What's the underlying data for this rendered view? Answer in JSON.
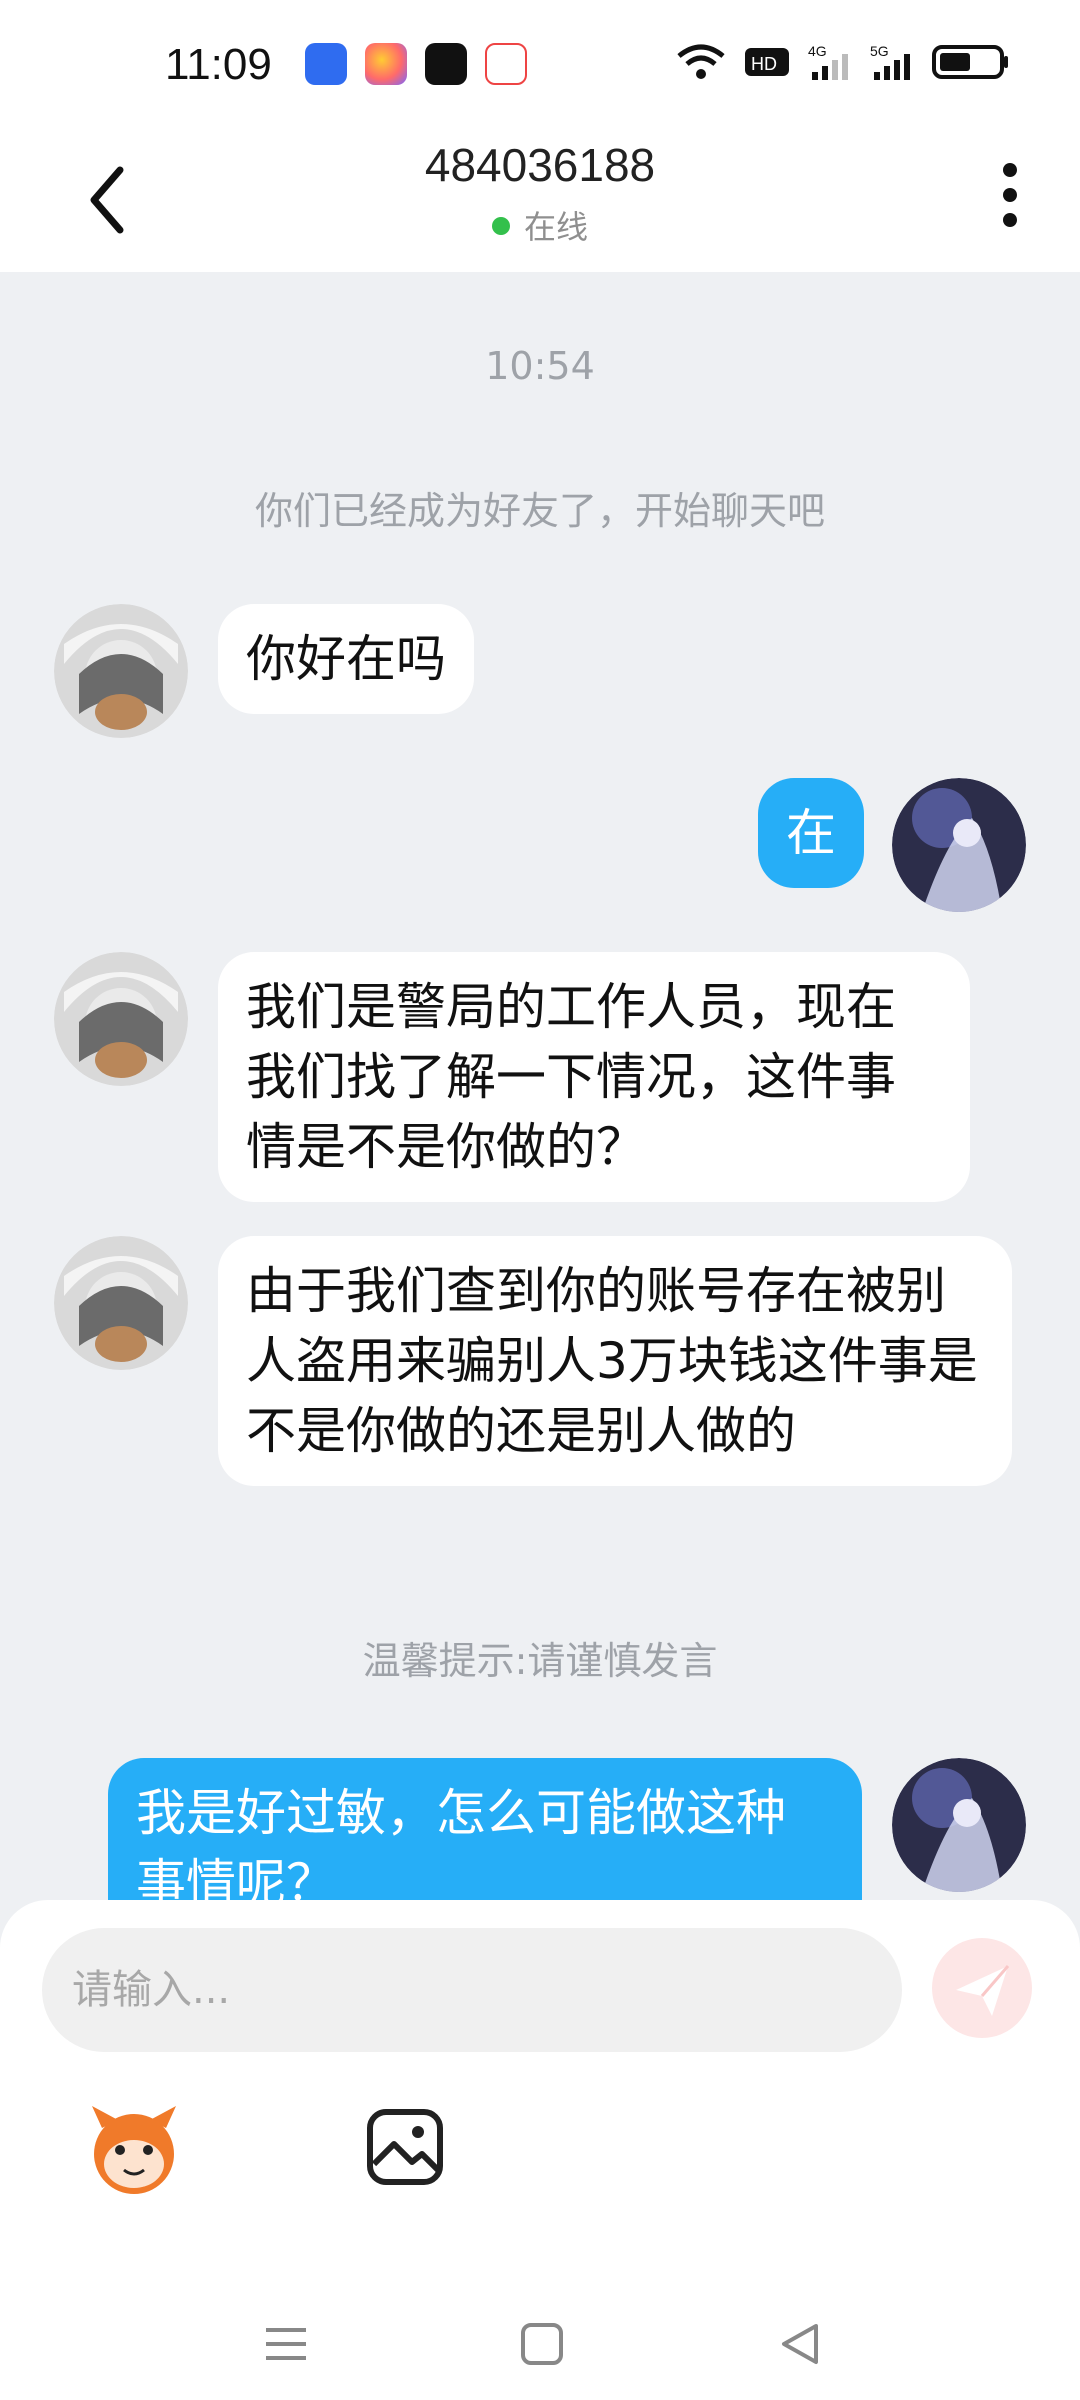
{
  "status_bar": {
    "time": "11:09"
  },
  "header": {
    "title": "484036188",
    "status": "在线"
  },
  "chat": {
    "timestamp": "10:54",
    "friend_notice": "你们已经成为好友了，开始聊天吧",
    "messages": [
      {
        "side": "left",
        "text": "你好在吗"
      },
      {
        "side": "right",
        "text": "在"
      },
      {
        "side": "left",
        "text": "我们是警局的工作人员，现在我们找了解一下情况，这件事情是不是你做的？"
      },
      {
        "side": "left",
        "text": "由于我们查到你的账号存在被别\n人盗用来骗别人3万块钱这件事是不是你做的还是别人做的"
      },
      {
        "side": "right",
        "text": "我是好过敏，怎么可能做这种事情呢？"
      }
    ],
    "warning": "温馨提示:请谨慎发言"
  },
  "input": {
    "placeholder": "请输入..."
  },
  "colors": {
    "outgoing_bubble": "#26aef7",
    "incoming_bubble": "#ffffff",
    "online_dot": "#33c04c",
    "background": "#eef0f3"
  },
  "icons": [
    "back-icon",
    "more-icon",
    "send-icon",
    "emoji-icon",
    "image-icon",
    "menu-nav-icon",
    "home-nav-icon",
    "back-nav-icon"
  ]
}
